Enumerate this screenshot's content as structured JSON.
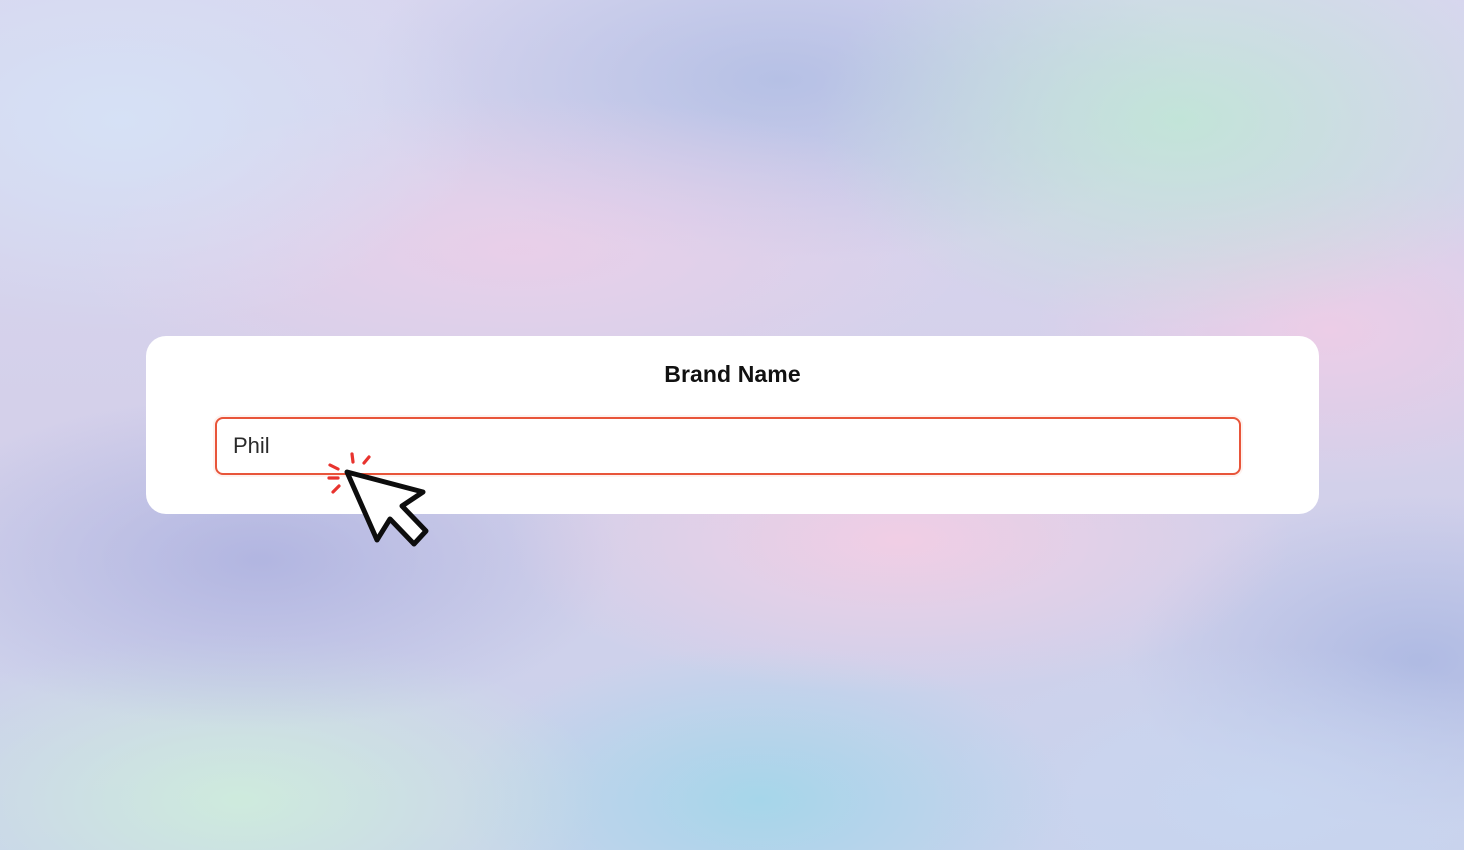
{
  "form": {
    "title": "Brand Name",
    "input_value": "Phil"
  },
  "icons": {
    "cursor": "mouse-pointer-click-icon"
  },
  "colors": {
    "input_border": "#e8553a",
    "click_burst": "#e8332e",
    "card_background": "#ffffff"
  }
}
